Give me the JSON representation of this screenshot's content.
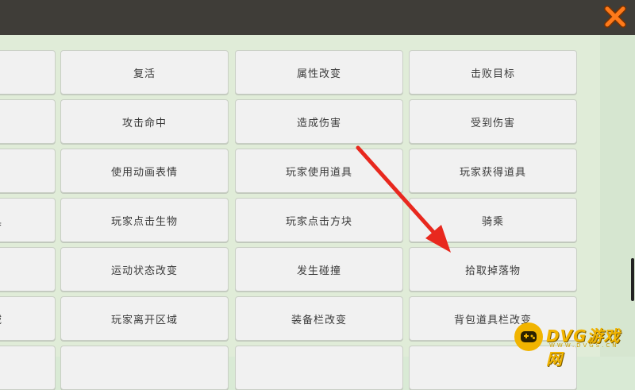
{
  "header": {
    "close_icon": "close-icon",
    "accent": "#ff7a1a"
  },
  "grid": {
    "rows": [
      [
        "",
        "复活",
        "属性改变",
        "击败目标"
      ],
      [
        "",
        "攻击命中",
        "造成伤害",
        "受到伤害"
      ],
      [
        "",
        "使用动画表情",
        "玩家使用道具",
        "玩家获得道具"
      ],
      [
        "具",
        "玩家点击生物",
        "玩家点击方块",
        "骑乘"
      ],
      [
        "",
        "运动状态改变",
        "发生碰撞",
        "拾取掉落物"
      ],
      [
        "域",
        "玩家离开区域",
        "装备栏改变",
        "背包道具栏改变"
      ],
      [
        "",
        "",
        "",
        ""
      ]
    ]
  },
  "annotation": {
    "color": "#e8281e",
    "icon": "red-arrow-icon"
  },
  "watermark": {
    "brand": "DVG游戏网",
    "sub": "WWW.DVGS.CN",
    "color": "#f1b400"
  }
}
